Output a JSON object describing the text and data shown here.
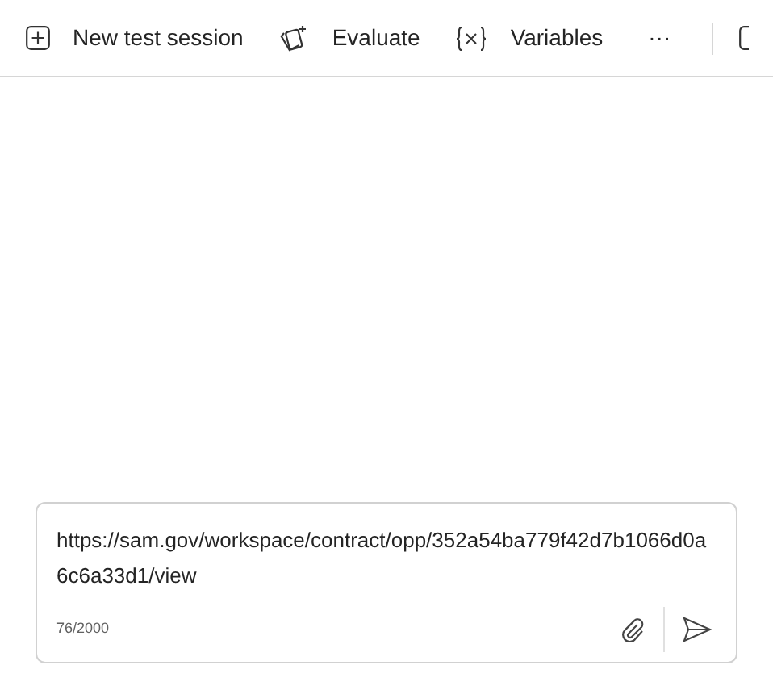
{
  "toolbar": {
    "items": [
      {
        "kind": "new",
        "label": "New test session"
      },
      {
        "kind": "evaluate",
        "label": "Evaluate"
      },
      {
        "kind": "variables",
        "label": "Variables"
      }
    ],
    "more": "···"
  },
  "composer": {
    "value": "https://sam.gov/workspace/contract/opp/352a54ba779f42d7b1066d0a6c6a33d1/view",
    "counter": "76/2000"
  }
}
